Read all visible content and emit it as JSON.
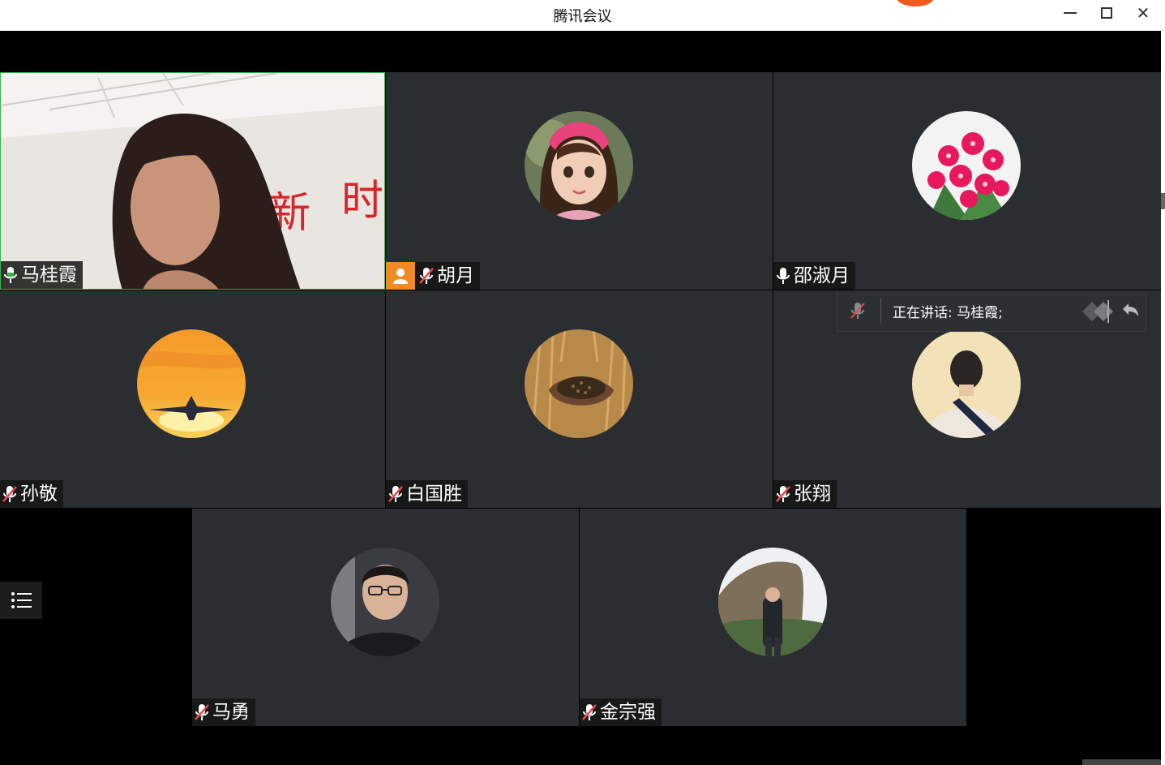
{
  "window": {
    "title": "腾讯会议",
    "controls": [
      "minimize",
      "maximize",
      "close"
    ]
  },
  "participants": [
    {
      "name": "马桂霞",
      "mic": "on",
      "video": "camera",
      "speaking": true
    },
    {
      "name": "胡月",
      "mic": "muted",
      "video": "avatar",
      "host": true,
      "avatar_icon": "girl-photo"
    },
    {
      "name": "邵淑月",
      "mic": "on",
      "video": "avatar",
      "avatar_icon": "pink-flowers"
    },
    {
      "name": "孙敬",
      "mic": "muted",
      "video": "avatar",
      "avatar_icon": "airplane-sunset"
    },
    {
      "name": "白国胜",
      "mic": "muted",
      "video": "avatar",
      "avatar_icon": "wheat-grain-hands"
    },
    {
      "name": "张翔",
      "mic": "muted",
      "video": "avatar",
      "avatar_icon": "man-backpack-illustration"
    },
    {
      "name": "马勇",
      "mic": "muted",
      "video": "avatar",
      "avatar_icon": "man-portrait"
    },
    {
      "name": "金宗强",
      "mic": "muted",
      "video": "avatar",
      "avatar_icon": "man-by-rocks"
    }
  ],
  "speaking_indicator": {
    "text": "正在讲话: 马桂霞;"
  },
  "colors": {
    "tile_bg": "#2b2e31",
    "active_border": "#3bb54a",
    "host_badge": "#f08a24",
    "mic_on": "#ffffff",
    "mic_muted_slash": "#e84a4a"
  }
}
